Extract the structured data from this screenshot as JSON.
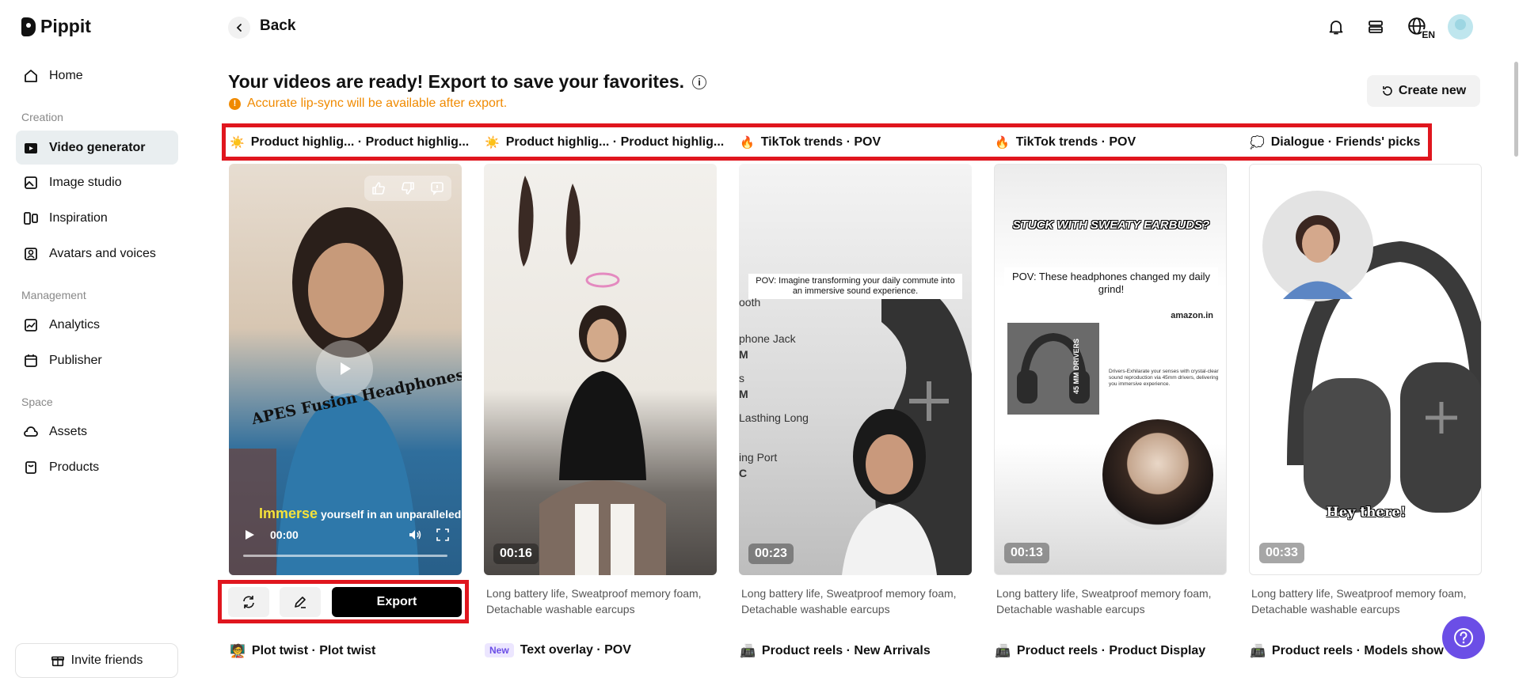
{
  "app": {
    "name": "Pippit"
  },
  "sidebar": {
    "items": [
      {
        "label": "Home",
        "icon": "home-icon"
      },
      {
        "label": "Video generator",
        "icon": "video-icon"
      },
      {
        "label": "Image studio",
        "icon": "image-icon"
      },
      {
        "label": "Inspiration",
        "icon": "inspiration-icon"
      },
      {
        "label": "Avatars and voices",
        "icon": "avatar-icon"
      },
      {
        "label": "Analytics",
        "icon": "analytics-icon"
      },
      {
        "label": "Publisher",
        "icon": "calendar-icon"
      },
      {
        "label": "Assets",
        "icon": "cloud-icon"
      },
      {
        "label": "Products",
        "icon": "box-icon"
      }
    ],
    "sections": {
      "creation": "Creation",
      "management": "Management",
      "space": "Space"
    },
    "invite": "Invite friends"
  },
  "header": {
    "back": "Back",
    "language": "EN",
    "title": "Your videos are ready! Export to save your favorites.",
    "warning": "Accurate lip-sync will be available after export.",
    "create_new": "Create new"
  },
  "tags": [
    {
      "emoji": "☀️",
      "label": "Product highlig... · Product highlig..."
    },
    {
      "emoji": "☀️",
      "label": "Product highlig... · Product highlig..."
    },
    {
      "emoji": "🔥",
      "label": "TikTok trends · POV"
    },
    {
      "emoji": "🔥",
      "label": "TikTok trends · POV"
    },
    {
      "emoji": "💭",
      "label": "Dialogue · Friends' picks"
    }
  ],
  "cards": [
    {
      "caption_top": "APES Fusion Headphones",
      "caption_bottom_highlight": "Immerse",
      "caption_bottom": " yourself in an unparalleled",
      "time": "00:00"
    },
    {
      "duration": "00:16",
      "desc": "Long battery life, Sweatproof memory foam, Detachable washable earcups"
    },
    {
      "duration": "00:23",
      "overlay": "POV: Imagine transforming your daily commute into an immersive sound experience.",
      "specs": [
        "ooth",
        "phone Jack",
        "M",
        "s",
        "M",
        "Lasthing Long",
        "ing Port",
        "C"
      ],
      "desc": "Long battery life, Sweatproof memory foam, Detachable washable earcups"
    },
    {
      "duration": "00:13",
      "headline": "STUCK WITH SWEATY EARBUDS?",
      "overlay": "POV: These headphones changed my daily grind!",
      "brand": "amazon.in",
      "side_label": "45 MM DRIVERS",
      "small_text": "Drivers-Exhilarate your senses with crystal-clear sound reproduction via 45mm drivers, delivering you immersive experience.",
      "desc": "Long battery life, Sweatproof memory foam, Detachable washable earcups"
    },
    {
      "duration": "00:33",
      "caption": "Hey there!",
      "desc": "Long battery life, Sweatproof memory foam, Detachable washable earcups"
    }
  ],
  "first_card_desc": "Long battery life, Sweatproof memory foam, Detachable washable earcups",
  "actions": {
    "export": "Export"
  },
  "footers": [
    {
      "emoji": "🧑‍🏫",
      "label": "Plot twist · Plot twist"
    },
    {
      "badge": "New",
      "label": "Text overlay · POV"
    },
    {
      "emoji": "📠",
      "label": "Product reels · New Arrivals"
    },
    {
      "emoji": "📠",
      "label": "Product reels · Product Display"
    },
    {
      "emoji": "📠",
      "label": "Product reels · Models show"
    }
  ],
  "colors": {
    "accent": "#6b4ee6",
    "warning": "#f08a00",
    "highlight_box": "#e0161e"
  }
}
